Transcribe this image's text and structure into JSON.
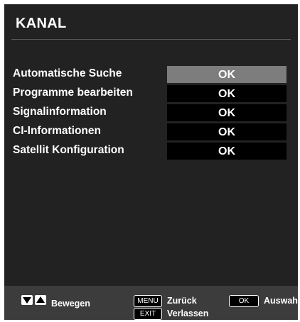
{
  "header": {
    "title": "KANAL"
  },
  "menu": {
    "items": [
      {
        "label": "Automatische Suche",
        "value": "OK",
        "selected": true
      },
      {
        "label": "Programme bearbeiten",
        "value": "OK",
        "selected": false
      },
      {
        "label": "Signalinformation",
        "value": "OK",
        "selected": false
      },
      {
        "label": "CI-Informationen",
        "value": "OK",
        "selected": false
      },
      {
        "label": "Satellit Konfiguration",
        "value": "OK",
        "selected": false
      }
    ]
  },
  "footer": {
    "move_label": "Bewegen",
    "menu_key": "MENU",
    "back_label": "Zurück",
    "ok_key": "OK",
    "select_label": "Auswahl",
    "exit_key": "EXIT",
    "exit_label": "Verlassen"
  },
  "colors": {
    "background": "#222222",
    "selected_value": "#7d7d7d",
    "value_box": "#000000",
    "footer": "#3c3c3c"
  }
}
